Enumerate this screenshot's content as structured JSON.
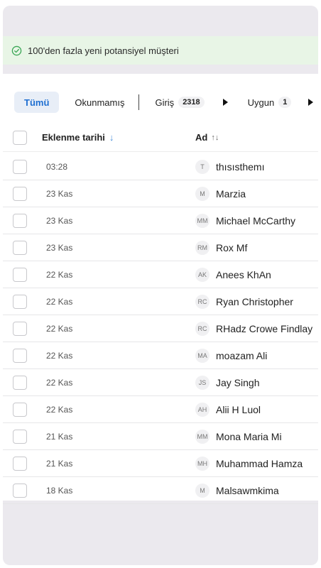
{
  "notification": {
    "icon": "check-circle-icon",
    "text": "100'den fazla yeni potansiyel müşteri",
    "color": "#3aa655"
  },
  "tabs": [
    {
      "label": "Tümü",
      "active": true
    },
    {
      "label": "Okunmamış",
      "active": false
    },
    {
      "label": "Giriş",
      "count": "2318"
    },
    {
      "label": "Uygun",
      "count": "1"
    }
  ],
  "table": {
    "columns": {
      "date": "Eklenme tarihi",
      "name": "Ad"
    },
    "rows": [
      {
        "date": "03:28",
        "initials": "T",
        "name": "thısısthemı"
      },
      {
        "date": "23 Kas",
        "initials": "M",
        "name": "Marzia"
      },
      {
        "date": "23 Kas",
        "initials": "MM",
        "name": "Michael McCarthy"
      },
      {
        "date": "23 Kas",
        "initials": "RM",
        "name": "Rox Mf"
      },
      {
        "date": "22 Kas",
        "initials": "AK",
        "name": "Anees KhAn"
      },
      {
        "date": "22 Kas",
        "initials": "RC",
        "name": "Ryan Christopher"
      },
      {
        "date": "22 Kas",
        "initials": "RC",
        "name": "RHadz Crowe Findlay"
      },
      {
        "date": "22 Kas",
        "initials": "MA",
        "name": "moazam Ali"
      },
      {
        "date": "22 Kas",
        "initials": "JS",
        "name": "Jay Singh"
      },
      {
        "date": "22 Kas",
        "initials": "AH",
        "name": "Alii H Luol"
      },
      {
        "date": "21 Kas",
        "initials": "MM",
        "name": "Mona Maria Mi"
      },
      {
        "date": "21 Kas",
        "initials": "MH",
        "name": "Muhammad Hamza"
      },
      {
        "date": "18 Kas",
        "initials": "M",
        "name": "Malsawmkima"
      }
    ]
  },
  "colors": {
    "accent": "#1f6fd1",
    "alert_bg": "#e8f5e6",
    "frame_bg": "#ebe9ee"
  }
}
